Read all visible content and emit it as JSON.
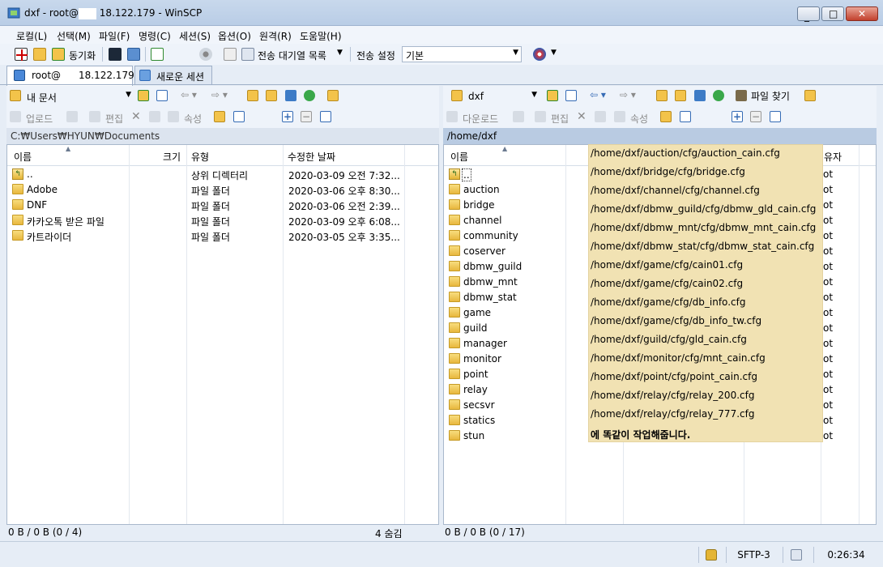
{
  "window": {
    "title_pre": "dxf - root@",
    "title_post": "18.122.179 - WinSCP",
    "buttons": [
      "_",
      "□",
      "✕"
    ]
  },
  "menu": [
    "로컬(L)",
    "선택(M)",
    "파일(F)",
    "명령(C)",
    "세션(S)",
    "옵션(O)",
    "원격(R)",
    "도움말(H)"
  ],
  "toolbar": {
    "sync_label": "동기화",
    "queue_label": "전송 대기열 목록",
    "transfer_settings_label": "전송 설정",
    "transfer_settings_value": "기본"
  },
  "tabs": {
    "session_user": "root@",
    "session_host": "18.122.179",
    "new_session": "새로운 세션"
  },
  "left": {
    "location": "내 문서",
    "upload": "업로드",
    "edit": "편집",
    "properties": "속성",
    "path": "C:₩Users₩HYUN₩Documents",
    "columns": [
      "이름",
      "크기",
      "유형",
      "수정한 날짜"
    ],
    "files": [
      {
        "name": "..",
        "size": "",
        "type": "상위 디렉터리",
        "modified": "2020-03-09  오전 7:32..."
      },
      {
        "name": "Adobe",
        "size": "",
        "type": "파일 폴더",
        "modified": "2020-03-06  오후 8:30..."
      },
      {
        "name": "DNF",
        "size": "",
        "type": "파일 폴더",
        "modified": "2020-03-06  오전 2:39..."
      },
      {
        "name": "카카오톡 받은 파일",
        "size": "",
        "type": "파일 폴더",
        "modified": "2020-03-09  오후 6:08..."
      },
      {
        "name": "카트라이더",
        "size": "",
        "type": "파일 폴더",
        "modified": "2020-03-05  오후 3:35..."
      }
    ],
    "status_left": "0 B / 0 B (0 / 4)",
    "status_right": "4 숨김"
  },
  "right": {
    "location": "dxf",
    "download": "다운로드",
    "edit": "편집",
    "properties": "속성",
    "find_files": "파일 찾기",
    "path": "/home/dxf",
    "columns": [
      "이름",
      "유자"
    ],
    "files": [
      "..",
      "auction",
      "bridge",
      "channel",
      "community",
      "coserver",
      "dbmw_guild",
      "dbmw_mnt",
      "dbmw_stat",
      "game",
      "guild",
      "manager",
      "monitor",
      "point",
      "relay",
      "secsvr",
      "statics",
      "stun"
    ],
    "owner_frag": "ot",
    "status": "0 B / 0 B (0 / 17)"
  },
  "tooltip": {
    "lines": [
      "/home/dxf/auction/cfg/auction_cain.cfg",
      "/home/dxf/bridge/cfg/bridge.cfg",
      "/home/dxf/channel/cfg/channel.cfg",
      "/home/dxf/dbmw_guild/cfg/dbmw_gld_cain.cfg",
      "/home/dxf/dbmw_mnt/cfg/dbmw_mnt_cain.cfg",
      "/home/dxf/dbmw_stat/cfg/dbmw_stat_cain.cfg",
      "/home/dxf/game/cfg/cain01.cfg",
      "/home/dxf/game/cfg/cain02.cfg",
      "/home/dxf/game/cfg/db_info.cfg",
      "/home/dxf/game/cfg/db_info_tw.cfg",
      "/home/dxf/guild/cfg/gld_cain.cfg",
      "/home/dxf/monitor/cfg/mnt_cain.cfg",
      "/home/dxf/point/cfg/point_cain.cfg",
      "/home/dxf/relay/cfg/relay_200.cfg",
      "/home/dxf/relay/cfg/relay_777.cfg"
    ],
    "footer": "에 똑같이 작업해줍니다."
  },
  "statusbar": {
    "protocol": "SFTP-3",
    "time": "0:26:34"
  },
  "colors": {
    "accent": "#b9cbe2",
    "folder": "#e8b73e",
    "tooltip": "#f1e2b3"
  }
}
